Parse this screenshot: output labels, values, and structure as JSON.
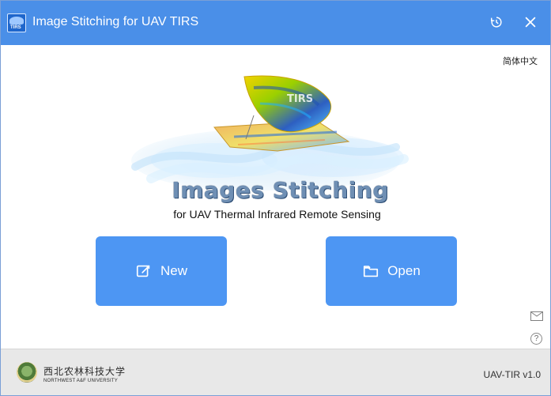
{
  "window": {
    "title": "Image Stitching for UAV TIRS",
    "app_icon_text": "TIRS"
  },
  "topbar": {
    "language_toggle": "简体中文"
  },
  "logo": {
    "title": "Images Stitching",
    "subtitle": "for UAV Thermal Infrared Remote Sensing",
    "sail_text": "TIRS"
  },
  "actions": {
    "new_label": "New",
    "open_label": "Open"
  },
  "footer": {
    "university_cn": "西北农林科技大学",
    "university_en": "NORTHWEST A&F UNIVERSITY",
    "version": "UAV-TIR v1.0"
  },
  "colors": {
    "titlebar": "#4a8fe8",
    "button": "#4d96f3",
    "footer_bg": "#e8e8e8"
  },
  "icons": {
    "history": "history-icon",
    "close": "close-icon",
    "new": "edit-icon",
    "open": "folder-icon",
    "mail": "mail-icon",
    "help": "help-icon"
  }
}
